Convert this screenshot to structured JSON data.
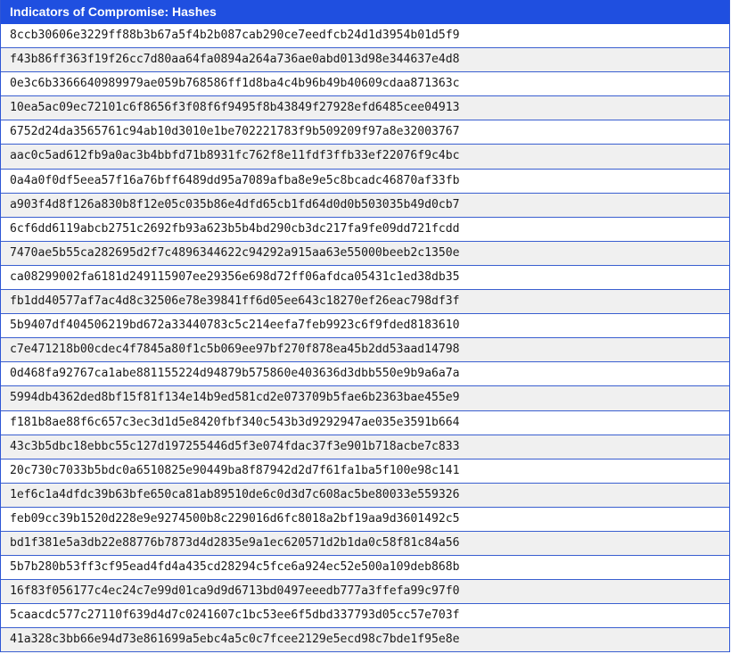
{
  "header": {
    "title": "Indicators of Compromise: Hashes"
  },
  "hashes": [
    "8ccb30606e3229ff88b3b67a5f4b2b087cab290ce7eedfcb24d1d3954b01d5f9",
    "f43b86ff363f19f26cc7d80aa64fa0894a264a736ae0abd013d98e344637e4d8",
    "0e3c6b3366640989979ae059b768586ff1d8ba4c4b96b49b40609cdaa871363c",
    "10ea5ac09ec72101c6f8656f3f08f6f9495f8b43849f27928efd6485cee04913",
    "6752d24da3565761c94ab10d3010e1be702221783f9b509209f97a8e32003767",
    "aac0c5ad612fb9a0ac3b4bbfd71b8931fc762f8e11fdf3ffb33ef22076f9c4bc",
    "0a4a0f0df5eea57f16a76bff6489dd95a7089afba8e9e5c8bcadc46870af33fb",
    "a903f4d8f126a830b8f12e05c035b86e4dfd65cb1fd64d0d0b503035b49d0cb7",
    "6cf6dd6119abcb2751c2692fb93a623b5b4bd290cb3dc217fa9fe09dd721fcdd",
    "7470ae5b55ca282695d2f7c4896344622c94292a915aa63e55000beeb2c1350e",
    "ca08299002fa6181d249115907ee29356e698d72ff06afdca05431c1ed38db35",
    "fb1dd40577af7ac4d8c32506e78e39841ff6d05ee643c18270ef26eac798df3f",
    "5b9407df404506219bd672a33440783c5c214eefa7feb9923c6f9fded8183610",
    "c7e471218b00cdec4f7845a80f1c5b069ee97bf270f878ea45b2dd53aad14798",
    "0d468fa92767ca1abe881155224d94879b575860e403636d3dbb550e9b9a6a7a",
    "5994db4362ded8bf15f81f134e14b9ed581cd2e073709b5fae6b2363bae455e9",
    "f181b8ae88f6c657c3ec3d1d5e8420fbf340c543b3d9292947ae035e3591b664",
    "43c3b5dbc18ebbc55c127d197255446d5f3e074fdac37f3e901b718acbe7c833",
    "20c730c7033b5bdc0a6510825e90449ba8f87942d2d7f61fa1ba5f100e98c141",
    "1ef6c1a4dfdc39b63bfe650ca81ab89510de6c0d3d7c608ac5be80033e559326",
    "feb09cc39b1520d228e9e9274500b8c229016d6fc8018a2bf19aa9d3601492c5",
    "bd1f381e5a3db22e88776b7873d4d2835e9a1ec620571d2b1da0c58f81c84a56",
    "5b7b280b53ff3cf95ead4fd4a435cd28294c5fce6a924ec52e500a109deb868b",
    "16f83f056177c4ec24c7e99d01ca9d9d6713bd0497eeedb777a3ffefa99c97f0",
    "5caacdc577c27110f639d4d7c0241607c1bc53ee6f5dbd337793d05cc57e703f",
    "41a328c3bb66e94d73e861699a5ebc4a5c0c7fcee2129e5ecd98c7bde1f95e8e"
  ]
}
